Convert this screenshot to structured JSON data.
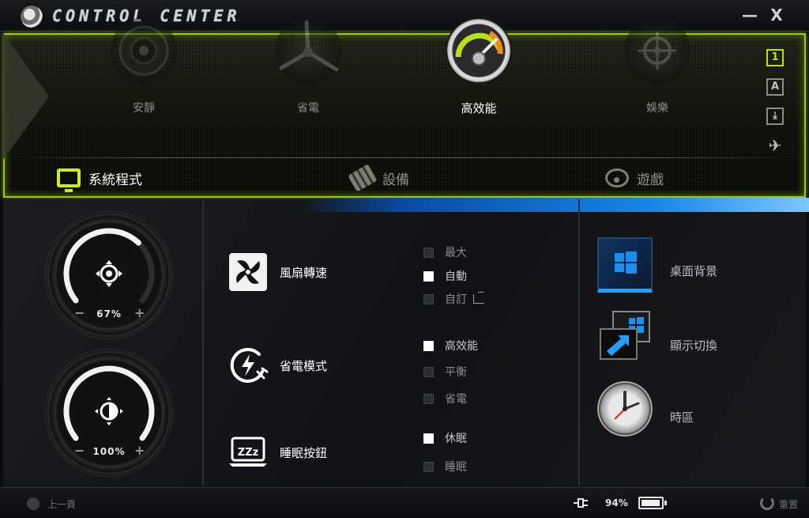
{
  "window": {
    "title": "CONTROL CENTER",
    "minimize": "—",
    "close": "X"
  },
  "modes": [
    {
      "label": "安靜",
      "icon": "speaker-icon",
      "active": false
    },
    {
      "label": "省電",
      "icon": "wind-turbine-icon",
      "active": false
    },
    {
      "label": "高效能",
      "icon": "speedometer-icon",
      "active": true
    },
    {
      "label": "娛樂",
      "icon": "crosshair-icon",
      "active": false
    }
  ],
  "side_icons": [
    {
      "glyph": "1",
      "name": "profile-1-icon",
      "active": true
    },
    {
      "glyph": "A",
      "name": "profile-a-icon",
      "active": false
    },
    {
      "glyph": "⤓",
      "name": "download-icon",
      "active": false
    },
    {
      "glyph": "✈",
      "name": "airplane-icon",
      "active": false
    }
  ],
  "tabs": [
    {
      "label": "系統程式",
      "icon": "monitor-icon",
      "active": true
    },
    {
      "label": "設備",
      "icon": "usb-icon",
      "active": false
    },
    {
      "label": "遊戲",
      "icon": "steering-wheel-icon",
      "active": false
    }
  ],
  "gauges": {
    "fan": {
      "value": "67%",
      "level": 0.67,
      "minus": "−",
      "plus": "+"
    },
    "brightness": {
      "value": "100%",
      "level": 1.0,
      "minus": "−",
      "plus": "+"
    }
  },
  "settings": {
    "fan": {
      "label": "風扇轉速",
      "options": [
        {
          "label": "最大",
          "checked": false
        },
        {
          "label": "自動",
          "checked": true
        },
        {
          "label": "自訂",
          "checked": false
        }
      ]
    },
    "power": {
      "label": "省電模式",
      "options": [
        {
          "label": "高效能",
          "checked": true
        },
        {
          "label": "平衡",
          "checked": false
        },
        {
          "label": "省電",
          "checked": false
        }
      ]
    },
    "sleep": {
      "label": "睡眠按鈕",
      "icon_text": "ZZz",
      "options": [
        {
          "label": "休眠",
          "checked": true
        },
        {
          "label": "睡眠",
          "checked": false
        }
      ]
    }
  },
  "right_items": [
    {
      "label": "桌面背景",
      "icon": "windows-desktop-icon"
    },
    {
      "label": "顯示切換",
      "icon": "display-switch-icon"
    },
    {
      "label": "時區",
      "icon": "clock-icon"
    }
  ],
  "status": {
    "back_label": "上一頁",
    "battery_pct": "94%",
    "battery_level": 0.94,
    "reset_label": "重置"
  },
  "colors": {
    "accent": "#b7e01c",
    "panel_border": "#9bc41c",
    "desktop_blue": "#1887e6"
  }
}
